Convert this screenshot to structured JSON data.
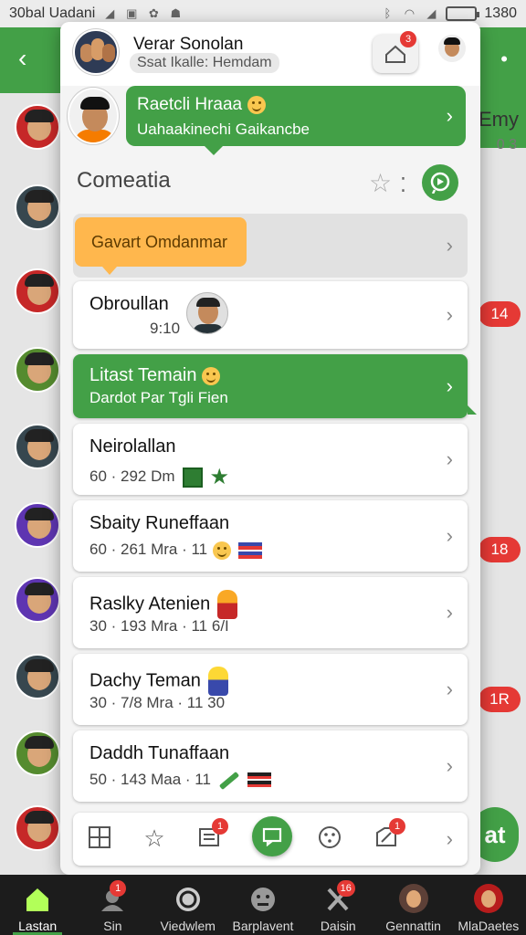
{
  "status_bar": {
    "left_text": "30bal Uadani",
    "time": "1380"
  },
  "dialog": {
    "title": "Verar Sonolan",
    "subtitle": "Ssat Ikalle: Hemdam",
    "top_badge": "3",
    "bubble": {
      "line1": "Raetcli Hraaa",
      "line2": "Uahaakinechi Gaikancbe"
    },
    "section_title": "Comeatia",
    "rows": [
      {
        "title": "Gavart Omdanmar"
      },
      {
        "title": "Obroullan",
        "meta": "9:10"
      },
      {
        "title": "Litast Temain",
        "meta": "Dardot Par Tgli Fien"
      },
      {
        "title": "Neirolallan",
        "meta": "60 · 292 Dm"
      },
      {
        "title": "Sbaity Runeffaan",
        "meta": "60 · 261 Mra · 11"
      },
      {
        "title": "Raslky Atenien",
        "meta": "30 · 193 Mra · 11 6/I"
      },
      {
        "title": "Dachy Teman",
        "meta": "30 · 7/8 Mra · 11 30"
      },
      {
        "title": "Daddh Tunaffaan",
        "meta": "50 · 143 Maa · 11"
      }
    ],
    "toolbar_badges": {
      "notes": "1",
      "edit": "1"
    }
  },
  "background": {
    "right_title": "Emy",
    "right_sub": "0 3",
    "pills": [
      "14",
      "18",
      "1R"
    ],
    "fab_label": "at"
  },
  "bottom_nav": [
    {
      "label": "Lastan",
      "badge": ""
    },
    {
      "label": "Sin",
      "badge": "1"
    },
    {
      "label": "Viedwlem",
      "badge": ""
    },
    {
      "label": "Barplavent",
      "badge": ""
    },
    {
      "label": "Daisin",
      "badge": "16"
    },
    {
      "label": "Gennattin",
      "badge": ""
    },
    {
      "label": "MlaDaetes",
      "badge": ""
    }
  ],
  "colors": {
    "accent_green": "#43a047",
    "orange_bubble": "#ffb74d",
    "badge_red": "#e53935"
  }
}
